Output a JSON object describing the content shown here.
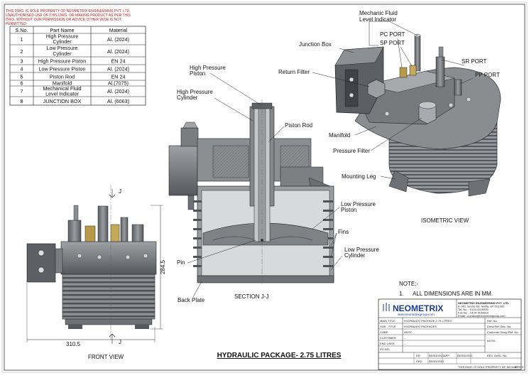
{
  "copyright": {
    "lines": [
      "THIS DWG. IS SOLE PROPERTY OF NEOMETRIX ENGINEERING PVT. LTD.",
      "UNAUTHORISED USE OF THIS DWG. OR MAKING PRODUCT AS PER THIS",
      "DWG. WITHOUT OUR PERMISSION OR ADVICE OTHER WISE IS NOT",
      "PERMITTED"
    ]
  },
  "parts_table": {
    "headers": [
      "S.No.",
      "Part Name",
      "Material"
    ],
    "rows": [
      {
        "no": "1",
        "name": [
          "High Pressure",
          "Cylinder"
        ],
        "material": "Al. (2024)"
      },
      {
        "no": "2",
        "name": [
          "Low Pressure",
          "Cylinder"
        ],
        "material": "Al. (2024)"
      },
      {
        "no": "3",
        "name": [
          "High Pressure Piston"
        ],
        "material": "EN 24"
      },
      {
        "no": "4",
        "name": [
          "Low Pressure Piston"
        ],
        "material": "Al. (2024)"
      },
      {
        "no": "5",
        "name": [
          "Piston Rod"
        ],
        "material": "EN 24"
      },
      {
        "no": "6",
        "name": [
          "Manifold"
        ],
        "material": "Al.(7075)"
      },
      {
        "no": "7",
        "name": [
          "Mechanical Fluid",
          "Level Indicator"
        ],
        "material": "Al. (2024)"
      },
      {
        "no": "8",
        "name": [
          "JUNCTION BOX"
        ],
        "material": "Al. (6063)"
      }
    ]
  },
  "labels": {
    "mech_fluid": [
      "Mechanic Fluid",
      "Level Indicator"
    ],
    "pc_port": "PC PORT",
    "sp_port": "SP PORT",
    "junction_box": "Junction Box",
    "sr_port": "SR PORT",
    "pp_port": "PP PORT",
    "return_filter": "Return Filter",
    "manifold": "Manifold",
    "pressure_filter": "Pressure Filter",
    "mounting_leg": "Mounting Leg",
    "hp_piston": [
      "High Pressure",
      "Piston"
    ],
    "hp_cylinder": [
      "High Pressure",
      "Cylinder"
    ],
    "piston_rod": "Piston Rod",
    "lp_piston": [
      "Low Pressure",
      "Piston"
    ],
    "fins": "Fins",
    "lp_cylinder": [
      "Low Pressure",
      "Cylinder"
    ],
    "pin": "Pin",
    "back_plate": "Back Plate"
  },
  "views": {
    "isometric": "ISOMETRIC VIEW",
    "section": "SECTION J-J",
    "front": "FRONT VIEW"
  },
  "dimensions": {
    "height": "284.5",
    "width": "310.5",
    "section_mark": "J"
  },
  "title": "HYDRAULIC PACKAGE- 2.75 LITRES",
  "note": {
    "heading": "NOTE:-",
    "item_no": "1.",
    "item": "ALL DIMENSIONS ARE IN MM."
  },
  "title_block": {
    "logo": "NEOMETRIX",
    "website": "www.neometrixgroup.com",
    "company_lines": [
      "NEOMETRIX ENGINEERING PVT. LTD.",
      "E-146, Sector-63, Noida, UP-201301",
      "Tel. No. : 0120-4100000",
      "Fax No. : 0120-4100010",
      "Email : contact@neometrixgroup.com"
    ],
    "right_fields": [
      "Ref. No.",
      "Drew Ref. Doc. No.",
      "Customer Drwg./Ref. No."
    ],
    "rows": [
      {
        "label": "MAIN TITLE",
        "value": "HYDRAULIC PACKAGE-2.75 LITRES"
      },
      {
        "label": "SUB - TITLE",
        "value": "HYDRAULIC PACKAGES"
      },
      {
        "label": "CODE",
        "value": "ASSY"
      },
      {
        "label": "CUSTOMER",
        "value": "--"
      },
      {
        "label": "END USER",
        "value": "--"
      },
      {
        "label": "PO NO.",
        "value": ""
      }
    ],
    "note_field": "NOTE:-",
    "bottom": {
      "rev_label": "REV. DWG. No.",
      "date_cells": [
        "DD/01/2021",
        "DD/01/2021",
        "DD/01/2021"
      ],
      "sign_cells": [
        "DD",
        "CKD",
        "APP"
      ],
      "bottom_text": "THIS DWG. IS SOLE PROPERTY OF NEOMETRIX",
      "sheet": "00"
    }
  },
  "colors": {
    "metal_dark": "#4f5256",
    "metal_mid": "#7a7d80",
    "metal_light": "#a3a6a8",
    "copyright_red": "#c4191b",
    "logo_blue": "#1e3c8c",
    "brass": "#b89a4a"
  }
}
